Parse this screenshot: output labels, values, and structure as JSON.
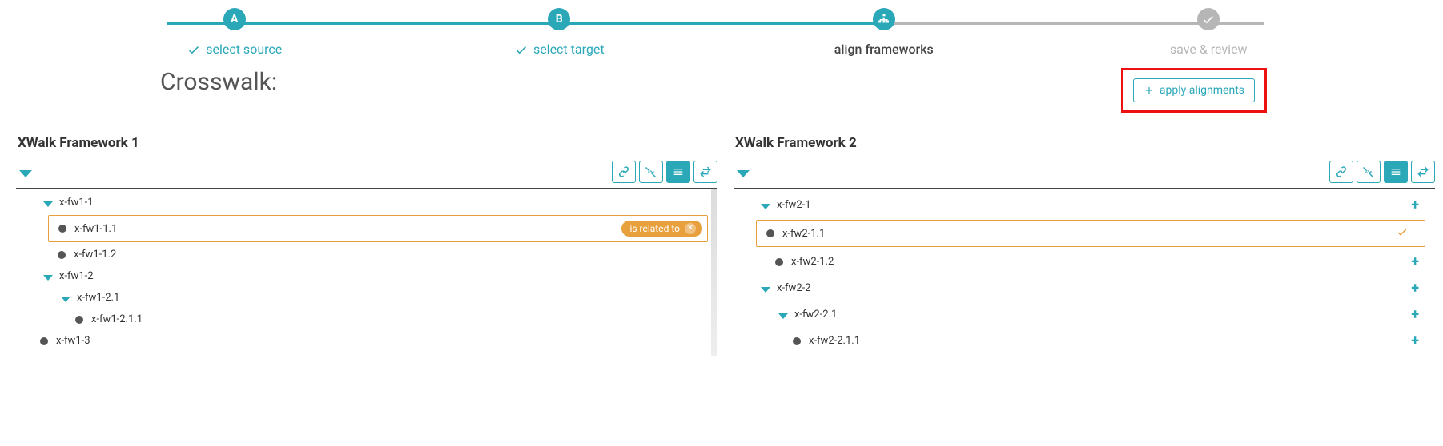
{
  "stepper": {
    "steps": [
      {
        "badge": "A",
        "label": "select source",
        "state": "done"
      },
      {
        "badge": "B",
        "label": "select target",
        "state": "done"
      },
      {
        "badge": "icon-align",
        "label": "align frameworks",
        "state": "current"
      },
      {
        "badge": "icon-check",
        "label": "save & review",
        "state": "pending"
      }
    ]
  },
  "title": "Crosswalk:",
  "apply_button": {
    "label": "apply alignments"
  },
  "panels": {
    "left": {
      "title": "XWalk Framework 1",
      "toolbar_icons": [
        "link",
        "unlink",
        "list-active",
        "swap"
      ],
      "tree": [
        {
          "type": "branch",
          "level": 0,
          "label": "x-fw1-1"
        },
        {
          "type": "leaf",
          "level": 1,
          "label": "x-fw1-1.1",
          "selected": true,
          "relation": "is related to"
        },
        {
          "type": "leaf",
          "level": 1,
          "label": "x-fw1-1.2"
        },
        {
          "type": "branch",
          "level": 0,
          "label": "x-fw1-2"
        },
        {
          "type": "branch",
          "level": 1,
          "label": "x-fw1-2.1"
        },
        {
          "type": "leaf",
          "level": 2,
          "label": "x-fw1-2.1.1"
        },
        {
          "type": "leaf",
          "level": 0,
          "label": "x-fw1-3"
        }
      ]
    },
    "right": {
      "title": "XWalk Framework 2",
      "toolbar_icons": [
        "link",
        "unlink",
        "list-active",
        "swap"
      ],
      "tree": [
        {
          "type": "branch",
          "level": 0,
          "label": "x-fw2-1",
          "action": "plus"
        },
        {
          "type": "leaf",
          "level": 1,
          "label": "x-fw2-1.1",
          "selected": true,
          "action": "check"
        },
        {
          "type": "leaf",
          "level": 1,
          "label": "x-fw2-1.2",
          "action": "plus"
        },
        {
          "type": "branch",
          "level": 0,
          "label": "x-fw2-2",
          "action": "plus"
        },
        {
          "type": "branch",
          "level": 1,
          "label": "x-fw2-2.1",
          "action": "plus"
        },
        {
          "type": "leaf",
          "level": 2,
          "label": "x-fw2-2.1.1",
          "action": "plus"
        }
      ]
    }
  }
}
